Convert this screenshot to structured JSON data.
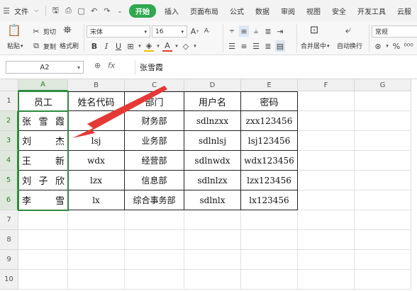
{
  "menu": {
    "file_label": "文件",
    "tabs": [
      "开始",
      "插入",
      "页面布局",
      "公式",
      "数据",
      "审阅",
      "视图",
      "安全",
      "开发工具",
      "云服"
    ]
  },
  "ribbon": {
    "paste": "粘贴",
    "cut": "剪切",
    "copy": "复制",
    "format_painter": "格式刷",
    "font_name": "宋体",
    "font_size": "16",
    "merge_center": "合并居中",
    "wrap_text": "自动换行",
    "number_format": "常规",
    "percent": "%"
  },
  "formula_bar": {
    "cell_ref": "A2",
    "fx": "fx",
    "value": "张雪霞"
  },
  "columns": [
    "A",
    "B",
    "C",
    "D",
    "E",
    "F",
    "G"
  ],
  "rows": [
    "1",
    "2",
    "3",
    "4",
    "5",
    "6",
    "7",
    "8",
    "9",
    "10"
  ],
  "table": {
    "headers": [
      "员工",
      "姓名代码",
      "部门",
      "用户名",
      "密码"
    ],
    "rows": [
      {
        "name": [
          "张",
          "雪",
          "霞"
        ],
        "code": "",
        "dept": "财务部",
        "user": "sdlnzxx",
        "pwd": "zxx123456"
      },
      {
        "name": [
          "刘",
          "",
          "杰"
        ],
        "code": "lsj",
        "dept": "业务部",
        "user": "sdlnlsj",
        "pwd": "lsj123456"
      },
      {
        "name": [
          "王",
          "",
          "新"
        ],
        "code": "wdx",
        "dept": "经营部",
        "user": "sdlnwdx",
        "pwd": "wdx123456"
      },
      {
        "name": [
          "刘",
          "子",
          "欣"
        ],
        "code": "lzx",
        "dept": "信息部",
        "user": "sdlnlzx",
        "pwd": "lzx123456"
      },
      {
        "name": [
          "李",
          "",
          "雪"
        ],
        "code": "lx",
        "dept": "综合事务部",
        "user": "sdlnlx",
        "pwd": "lx123456"
      }
    ]
  },
  "colors": {
    "accent": "#2fa84f",
    "selection": "#2e8b3e",
    "arrow": "#e53935"
  }
}
